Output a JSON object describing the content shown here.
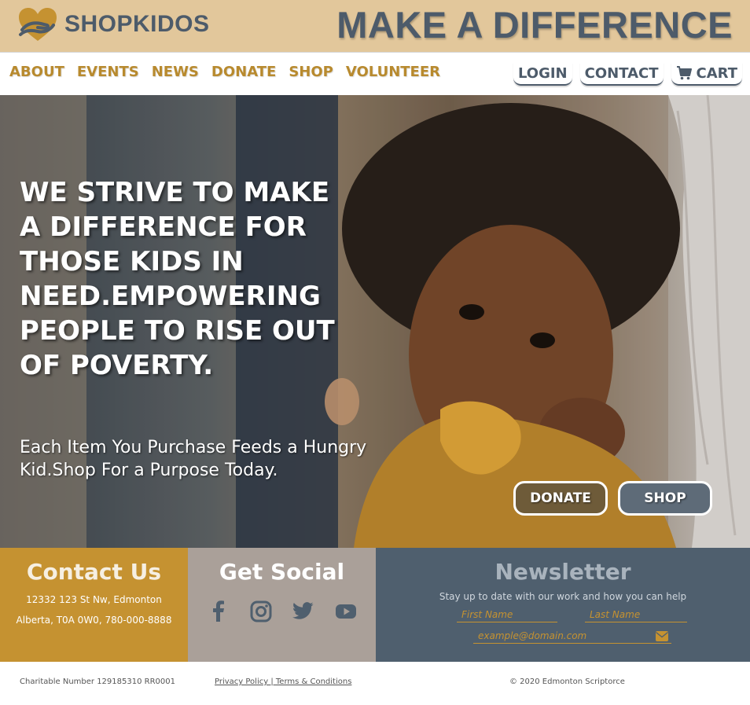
{
  "brand": {
    "name": "SHOPKIDOS",
    "tagline": "MAKE A DIFFERENCE"
  },
  "nav": {
    "left": [
      "ABOUT",
      "EVENTS",
      "NEWS",
      "DONATE",
      "SHOP",
      "VOLUNTEER"
    ],
    "login": "LOGIN",
    "contact": "CONTACT",
    "cart": "CART"
  },
  "hero": {
    "headline": "WE STRIVE TO MAKE A DIFFERENCE FOR THOSE KIDS IN NEED.EMPOWERING PEOPLE TO RISE OUT OF POVERTY.",
    "subtext": "Each Item You Purchase Feeds a Hungry Kid.Shop For a Purpose Today.",
    "donate_label": "DONATE",
    "shop_label": "SHOP"
  },
  "contact": {
    "title": "Contact Us",
    "address_line": "12332 123 St Nw, Edmonton",
    "city_line": "Alberta, T0A 0W0, 780-000-8888"
  },
  "social": {
    "title": "Get Social",
    "icons": [
      "facebook-icon",
      "instagram-icon",
      "twitter-icon",
      "youtube-icon"
    ]
  },
  "newsletter": {
    "title": "Newsletter",
    "description": "Stay up to date with our work and how you can help",
    "first_name_placeholder": "First Name",
    "last_name_placeholder": "Last Name",
    "email_placeholder": "example@domain.com"
  },
  "footer": {
    "charitable": "Charitable Number 129185310 RR0001",
    "policy": "Privacy Policy | Terms & Conditions",
    "copyright": "© 2020 Edmonton Scriptorce"
  },
  "colors": {
    "banner": "#e2c79b",
    "slate": "#4d5b6a",
    "gold": "#c59231",
    "stone": "#aaa099",
    "newsletter_bg": "#4f5f6e"
  }
}
